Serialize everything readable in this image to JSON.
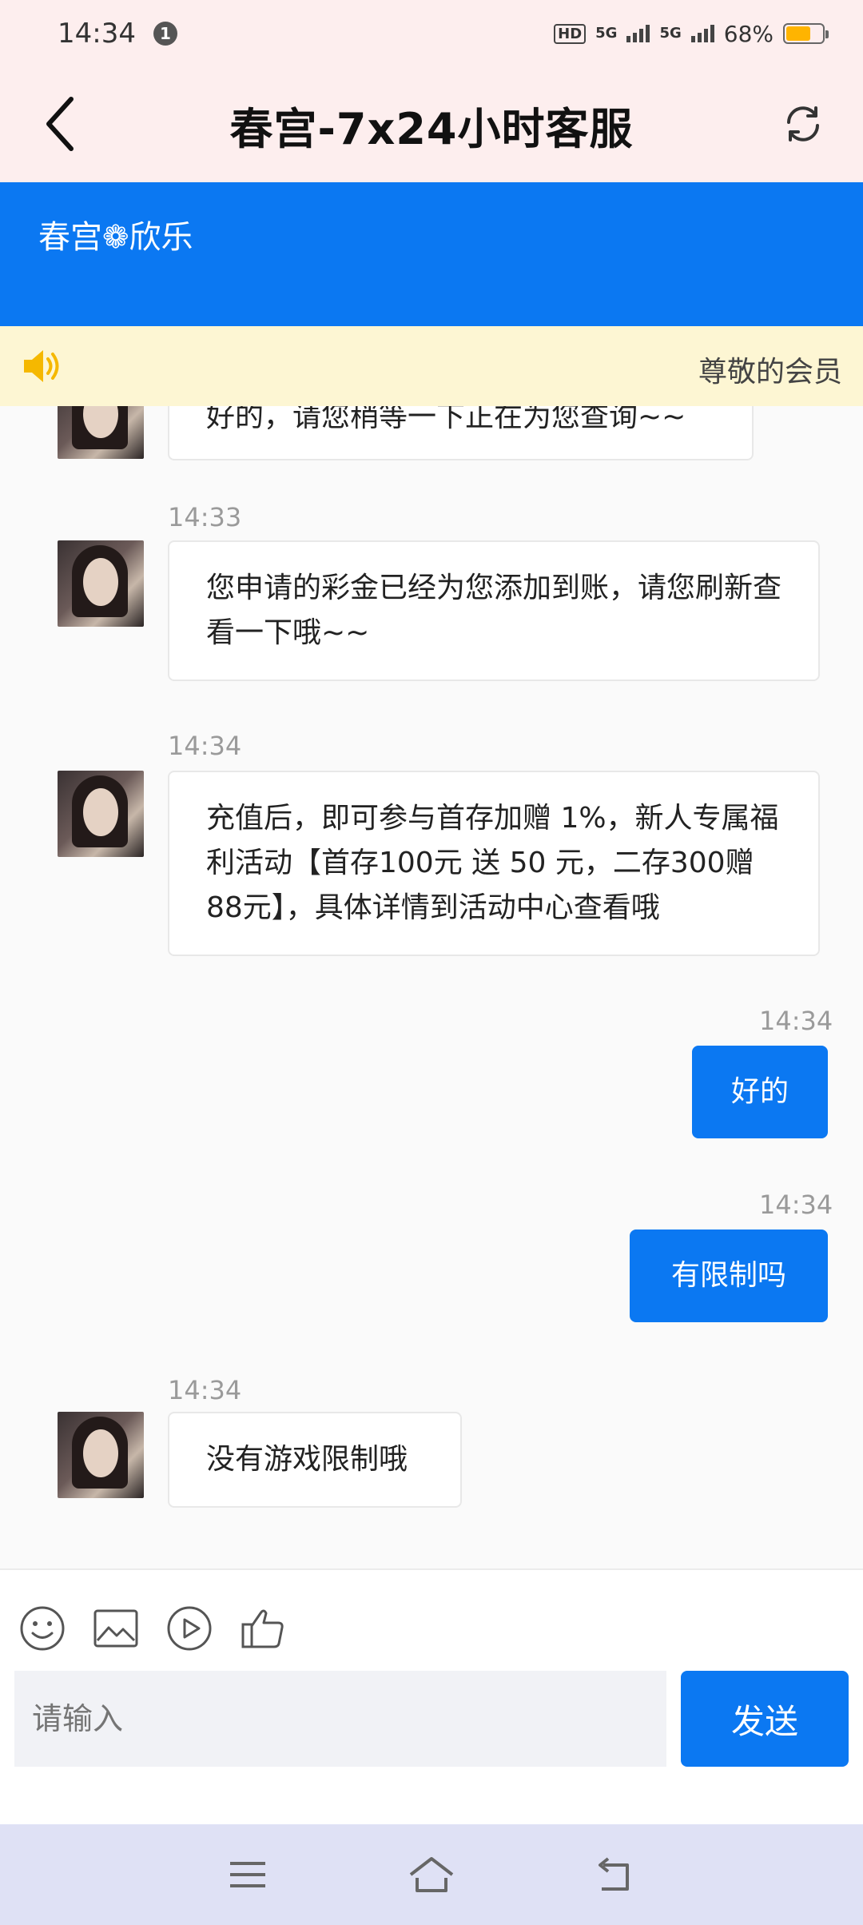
{
  "status_bar": {
    "time": "14:34",
    "notification_count": "1",
    "hd_badge": "HD",
    "network1": "5G",
    "network2": "5G",
    "battery": "68%",
    "battery_level": 0.68,
    "battery_color": "#ffb400"
  },
  "header": {
    "title": "春宫-7x24小时客服",
    "back_icon": "chevron-left-icon",
    "refresh_icon": "refresh-icon"
  },
  "banner": {
    "brand": "春宫❁欣乐",
    "color": "#0b78f2"
  },
  "notice": {
    "text": "尊敬的会员",
    "icon": "speaker-icon",
    "color": "#fdf6d3"
  },
  "messages": [
    {
      "side": "agent",
      "time": "",
      "text": "好的，请您稍等一下正在为您查询~~"
    },
    {
      "side": "agent",
      "time": "14:33",
      "text": "您申请的彩金已经为您添加到账，请您刷新查看一下哦~~"
    },
    {
      "side": "agent",
      "time": "14:34",
      "text": "充值后，即可参与首存加赠 1%，新人专属福利活动【首存100元 送 50 元，二存300赠88元】，具体详情到活动中心查看哦"
    },
    {
      "side": "user",
      "time": "14:34",
      "text": "好的"
    },
    {
      "side": "user",
      "time": "14:34",
      "text": "有限制吗"
    },
    {
      "side": "agent",
      "time": "14:34",
      "text": "没有游戏限制哦"
    }
  ],
  "composer": {
    "placeholder": "请输入",
    "send_label": "发送",
    "tools": [
      "smiley-icon",
      "image-icon",
      "play-icon",
      "thumbs-up-icon"
    ]
  },
  "nav": {
    "buttons": [
      "menu-icon",
      "home-icon",
      "back-icon"
    ]
  }
}
